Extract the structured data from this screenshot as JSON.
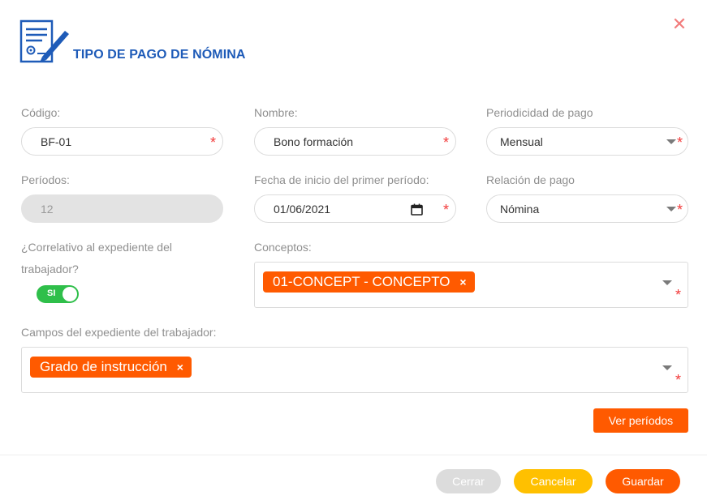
{
  "header": {
    "title": "TIPO DE PAGO DE NÓMINA",
    "icon": "form-edit-icon",
    "close_icon": "close-icon",
    "close_symbol": "✕"
  },
  "fields": {
    "codigo": {
      "label": "Código:",
      "value": "BF-01",
      "required_mark": "*"
    },
    "nombre": {
      "label": "Nombre:",
      "value": "Bono formación",
      "required_mark": "*"
    },
    "periodicidad": {
      "label": "Periodicidad de pago",
      "value": "Mensual",
      "required_mark": "*"
    },
    "periodos": {
      "label": "Períodos:",
      "value": "12"
    },
    "fecha_inicio": {
      "label": "Fecha de inicio del primer período:",
      "value": "01/06/2021",
      "required_mark": "*"
    },
    "relacion": {
      "label": "Relación de pago",
      "value": "Nómina",
      "required_mark": "*"
    },
    "correlativo": {
      "label": "¿Correlativo al expediente del trabajador?",
      "toggle_text": "SI"
    },
    "conceptos": {
      "label": "Conceptos:",
      "chips": [
        "01-CONCEPT - CONCEPTO"
      ],
      "required_mark": "*"
    },
    "campos": {
      "label": "Campos del expediente del trabajador:",
      "chips": [
        "Grado de instrucción"
      ],
      "required_mark": "*"
    }
  },
  "chip_remove_symbol": "×",
  "buttons": {
    "ver_periodos": "Ver períodos",
    "cerrar": "Cerrar",
    "cancelar": "Cancelar",
    "guardar": "Guardar"
  },
  "colors": {
    "brand_blue": "#1e5bb8",
    "accent_orange": "#ff5a00",
    "cancel_yellow": "#ffc000",
    "toggle_green": "#2fbf4a",
    "required_red": "#f23b3b"
  }
}
